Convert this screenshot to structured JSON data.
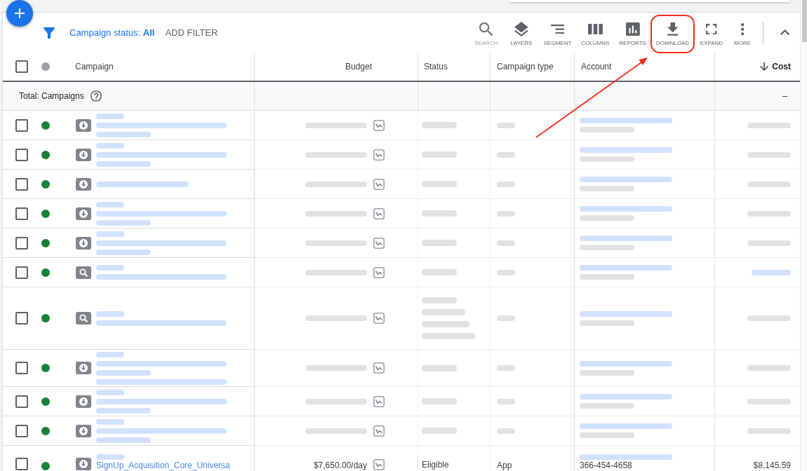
{
  "filter_bar": {
    "status_filter": "Campaign status: **All**",
    "add_filter": "ADD FILTER"
  },
  "toolbar": [
    {
      "label": "SEARCH",
      "kind": "search",
      "disabled": true,
      "highlighted": false
    },
    {
      "label": "LAYERS",
      "kind": "layers",
      "disabled": false,
      "highlighted": false
    },
    {
      "label": "SEGMENT",
      "kind": "segment",
      "disabled": false,
      "highlighted": false
    },
    {
      "label": "COLUMNS",
      "kind": "columns",
      "disabled": false,
      "highlighted": false
    },
    {
      "label": "REPORTS",
      "kind": "reports",
      "disabled": false,
      "highlighted": false
    },
    {
      "label": "DOWNLOAD",
      "kind": "download",
      "disabled": false,
      "highlighted": true
    },
    {
      "label": "EXPAND",
      "kind": "expand",
      "disabled": false,
      "highlighted": false
    },
    {
      "label": "MORE",
      "kind": "more",
      "disabled": false,
      "highlighted": false
    }
  ],
  "table": {
    "select_all": {
      "checked": false
    },
    "columns": [
      {
        "label": "Campaign",
        "kind": "text",
        "sorted": false
      },
      {
        "label": "Budget",
        "kind": "budget",
        "sorted": false
      },
      {
        "label": "Status",
        "kind": "text",
        "sorted": false
      },
      {
        "label": "Campaign type",
        "kind": "text",
        "sorted": false
      },
      {
        "label": "Account",
        "kind": "text",
        "sorted": false
      },
      {
        "label": "Cost",
        "kind": "number",
        "sorted": true
      }
    ],
    "total": {
      "label": "Total: Campaigns",
      "cost": "–"
    },
    "rows": [
      {
        "checked": false,
        "color": "#188038",
        "kind": "app",
        "campaign": [
          {
            "kind": "blurlink"
          },
          {
            "kind": "blurlink"
          },
          {
            "kind": "blurlink"
          }
        ],
        "budget": [
          {
            "kind": "blur"
          }
        ],
        "status": [
          {
            "kind": "blur"
          }
        ],
        "campaign_type": [
          {
            "kind": "blur"
          }
        ],
        "account": [
          {
            "kind": "blurlink"
          },
          {
            "kind": "blur"
          }
        ],
        "cost": [
          {
            "kind": "blur"
          }
        ]
      },
      {
        "checked": false,
        "color": "#188038",
        "kind": "app",
        "campaign": [
          {
            "kind": "blurlink"
          },
          {
            "kind": "blurlink"
          },
          {
            "kind": "blurlink"
          }
        ],
        "budget": [
          {
            "kind": "blur"
          }
        ],
        "status": [
          {
            "kind": "blur"
          }
        ],
        "campaign_type": [
          {
            "kind": "blur"
          }
        ],
        "account": [
          {
            "kind": "blurlink"
          },
          {
            "kind": "blur"
          }
        ],
        "cost": [
          {
            "kind": "blur"
          }
        ]
      },
      {
        "checked": false,
        "color": "#188038",
        "kind": "app",
        "campaign": [
          {
            "kind": "blurlink"
          }
        ],
        "budget": [
          {
            "kind": "blur"
          }
        ],
        "status": [
          {
            "kind": "blur"
          }
        ],
        "campaign_type": [
          {
            "kind": "blur"
          }
        ],
        "account": [
          {
            "kind": "blurlink"
          },
          {
            "kind": "blur"
          }
        ],
        "cost": [
          {
            "kind": "blur"
          }
        ]
      },
      {
        "checked": false,
        "color": "#188038",
        "kind": "app",
        "campaign": [
          {
            "kind": "blurlink"
          },
          {
            "kind": "blurlink"
          },
          {
            "kind": "blurlink"
          }
        ],
        "budget": [
          {
            "kind": "blur"
          }
        ],
        "status": [
          {
            "kind": "blur"
          }
        ],
        "campaign_type": [
          {
            "kind": "blur"
          }
        ],
        "account": [
          {
            "kind": "blurlink"
          },
          {
            "kind": "blur"
          }
        ],
        "cost": [
          {
            "kind": "blur"
          }
        ]
      },
      {
        "checked": false,
        "color": "#188038",
        "kind": "app",
        "campaign": [
          {
            "kind": "blurlink"
          },
          {
            "kind": "blurlink"
          },
          {
            "kind": "blurlink"
          }
        ],
        "budget": [
          {
            "kind": "blur"
          }
        ],
        "status": [
          {
            "kind": "blur"
          }
        ],
        "campaign_type": [
          {
            "kind": "blur"
          }
        ],
        "account": [
          {
            "kind": "blurlink"
          },
          {
            "kind": "blur"
          }
        ],
        "cost": [
          {
            "kind": "blur"
          }
        ]
      },
      {
        "checked": false,
        "color": "#188038",
        "kind": "search",
        "campaign": [
          {
            "kind": "blurlink"
          },
          {
            "kind": "blurlink"
          }
        ],
        "budget": [
          {
            "kind": "blur"
          }
        ],
        "status": [
          {
            "kind": "blur"
          }
        ],
        "campaign_type": [
          {
            "kind": "blur"
          }
        ],
        "account": [
          {
            "kind": "blurlink"
          },
          {
            "kind": "blur"
          }
        ],
        "cost": [
          {
            "kind": "blurlink"
          }
        ]
      },
      {
        "checked": false,
        "color": "#188038",
        "kind": "search",
        "campaign": [
          {
            "kind": "blurlink"
          },
          {
            "kind": "blurlink"
          }
        ],
        "budget": [
          {
            "kind": "blur"
          }
        ],
        "status": [
          {
            "kind": "blur"
          },
          {
            "kind": "blur"
          },
          {
            "kind": "blur"
          },
          {
            "kind": "blur"
          }
        ],
        "campaign_type": [
          {
            "kind": "blur"
          }
        ],
        "account": [
          {
            "kind": "blurlink"
          },
          {
            "kind": "blur"
          }
        ],
        "cost": [
          {
            "kind": "blur"
          }
        ]
      },
      {
        "checked": false,
        "color": "#188038",
        "kind": "app",
        "campaign": [
          {
            "kind": "blurlink"
          },
          {
            "kind": "blurlink"
          },
          {
            "kind": "blurlink"
          },
          {
            "kind": "blurlink"
          }
        ],
        "budget": [
          {
            "kind": "blur"
          }
        ],
        "status": [
          {
            "kind": "blur"
          }
        ],
        "campaign_type": [
          {
            "kind": "blur"
          }
        ],
        "account": [
          {
            "kind": "blurlink"
          },
          {
            "kind": "blur"
          }
        ],
        "cost": [
          {
            "kind": "blur"
          }
        ]
      },
      {
        "checked": false,
        "color": "#188038",
        "kind": "app",
        "campaign": [
          {
            "kind": "blurlink"
          },
          {
            "kind": "blurlink"
          },
          {
            "kind": "blurlink"
          }
        ],
        "budget": [
          {
            "kind": "blur"
          }
        ],
        "status": [
          {
            "kind": "blur"
          }
        ],
        "campaign_type": [
          {
            "kind": "blur"
          }
        ],
        "account": [
          {
            "kind": "blurlink"
          },
          {
            "kind": "blur"
          }
        ],
        "cost": [
          {
            "kind": "blur"
          }
        ]
      },
      {
        "checked": false,
        "color": "#188038",
        "kind": "app",
        "campaign": [
          {
            "kind": "blurlink"
          },
          {
            "kind": "blurlink"
          },
          {
            "kind": "blurlink"
          }
        ],
        "budget": [
          {
            "kind": "blur"
          }
        ],
        "status": [
          {
            "kind": "blur"
          }
        ],
        "campaign_type": [
          {
            "kind": "blur"
          }
        ],
        "account": [
          {
            "kind": "blurlink"
          },
          {
            "kind": "blur"
          }
        ],
        "cost": [
          {
            "kind": "blur"
          }
        ]
      },
      {
        "checked": false,
        "color": "#188038",
        "kind": "app",
        "campaign": [
          {
            "kind": "blurlink"
          },
          {
            "kind": "link",
            "text": "SignUp_Acquisition_Core_Universa"
          }
        ],
        "budget": [
          {
            "kind": "text",
            "text": "$7,650.00/day"
          }
        ],
        "status": [
          {
            "kind": "text",
            "text": "Eligible"
          }
        ],
        "campaign_type": [
          {
            "kind": "text",
            "text": "App"
          }
        ],
        "account": [
          {
            "kind": "blurlink"
          },
          {
            "kind": "text",
            "text": "366-454-4658"
          }
        ],
        "cost": [
          {
            "kind": "text",
            "text": "$8,145.59"
          }
        ]
      }
    ]
  }
}
